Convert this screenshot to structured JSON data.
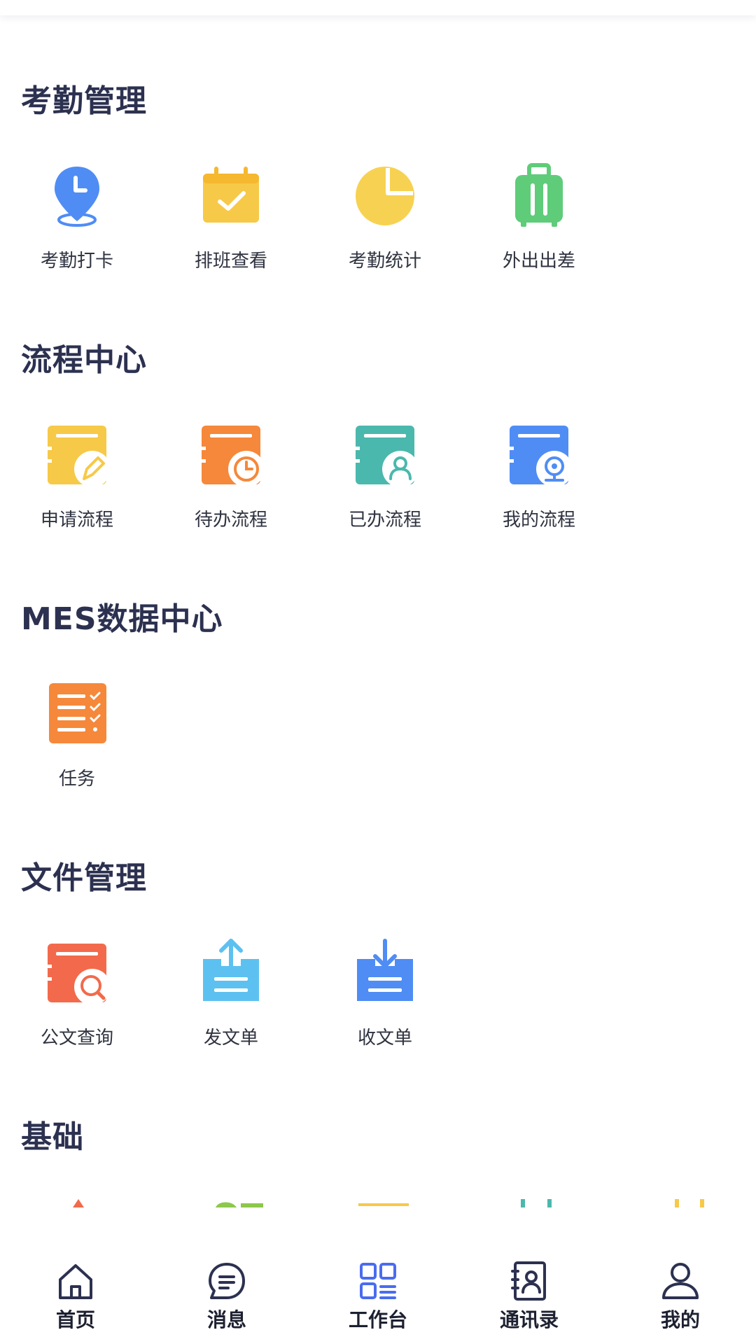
{
  "colors": {
    "title": "#2c3150",
    "blue": "#4f8df5",
    "yellow": "#f7c948",
    "orange": "#f5883a",
    "teal": "#4bb8ad",
    "green": "#5fcc7a",
    "red": "#f26a4b",
    "sky": "#5cc1f0",
    "active_tab": "#4a6cf0",
    "tab_icon": "#2c3150"
  },
  "sections": [
    {
      "title": "考勤管理",
      "items": [
        {
          "label": "考勤打卡",
          "icon": "location-clock-icon"
        },
        {
          "label": "排班查看",
          "icon": "calendar-check-icon"
        },
        {
          "label": "考勤统计",
          "icon": "pie-chart-icon"
        },
        {
          "label": "外出出差",
          "icon": "luggage-icon"
        }
      ]
    },
    {
      "title": "流程中心",
      "items": [
        {
          "label": "申请流程",
          "icon": "form-edit-icon"
        },
        {
          "label": "待办流程",
          "icon": "form-clock-icon"
        },
        {
          "label": "已办流程",
          "icon": "form-user-icon"
        },
        {
          "label": "我的流程",
          "icon": "form-camera-icon"
        }
      ]
    },
    {
      "title": "MES数据中心",
      "items": [
        {
          "label": "任务",
          "icon": "task-list-icon"
        }
      ]
    },
    {
      "title": "文件管理",
      "items": [
        {
          "label": "公文查询",
          "icon": "document-search-icon"
        },
        {
          "label": "发文单",
          "icon": "upload-tray-icon"
        },
        {
          "label": "收文单",
          "icon": "download-tray-icon"
        }
      ]
    },
    {
      "title": "基础",
      "items": []
    }
  ],
  "tabbar": [
    {
      "label": "首页",
      "icon": "home-icon"
    },
    {
      "label": "消息",
      "icon": "message-icon"
    },
    {
      "label": "工作台",
      "icon": "grid-icon",
      "active": true
    },
    {
      "label": "通讯录",
      "icon": "contacts-icon"
    },
    {
      "label": "我的",
      "icon": "user-icon"
    }
  ]
}
